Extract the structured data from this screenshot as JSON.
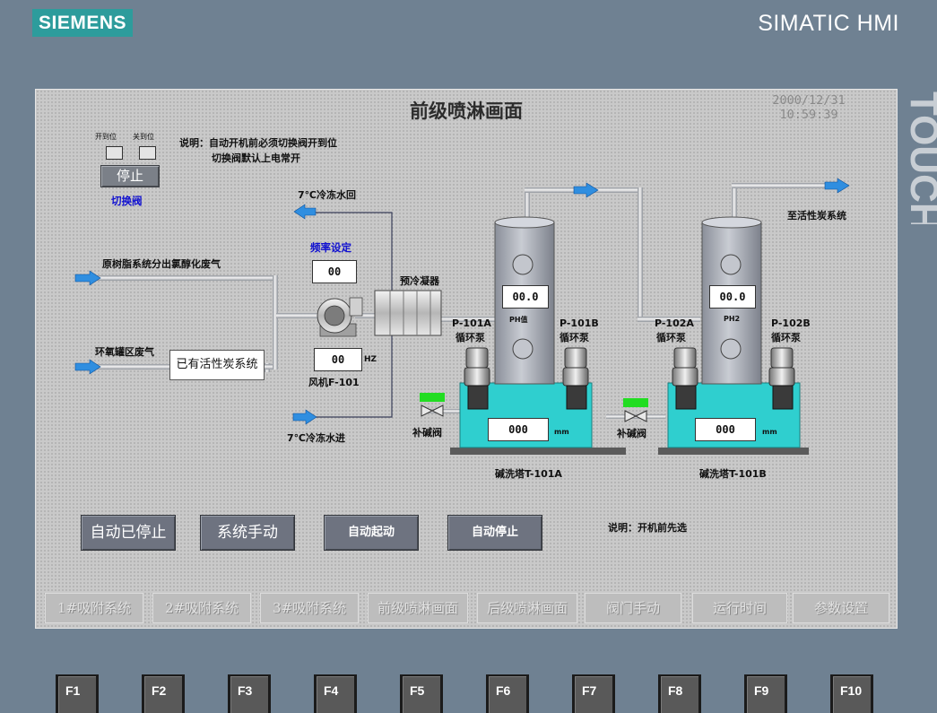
{
  "brand": "SIEMENS",
  "product": "SIMATIC HMI",
  "touch_label": "TOUCH",
  "screen": {
    "title": "前级喷淋画面",
    "date": "2000/12/31",
    "time": "10:59:39",
    "note_line1": "说明：自动开机前必须切换阀开到位",
    "note_line2": "切换阀默认上电常开",
    "note_bottom": "说明：开机前先选"
  },
  "switch_valve": {
    "open_label": "开到位",
    "close_label": "关到位",
    "button_label": "停止",
    "name": "切换阀"
  },
  "labels": {
    "cold_return": "7℃冷冻水回",
    "cold_in": "7℃冷冻水进",
    "freq_title": "频率设定",
    "source_gas": "原树脂系统分出氯醇化废气",
    "epoxy_gas": "环氧罐区废气",
    "carbon_system": "已有活性炭系统",
    "fan": "风机F-101",
    "precooler": "预冷凝器",
    "to_carbon": "至活性炭系统",
    "ph1": "PH值",
    "ph2": "PH2",
    "p101a": "P-101A",
    "p101b": "P-101B",
    "p102a": "P-102A",
    "p102b": "P-102B",
    "pump": "循环泵",
    "alkali_valve": "补碱阀",
    "tower_a": "碱洗塔T-101A",
    "tower_b": "碱洗塔T-101B",
    "hz": "HZ",
    "mm": "mm"
  },
  "values": {
    "freq_set": "00",
    "fan_freq": "00",
    "ph1": "00.0",
    "ph2": "00.0",
    "level_a": "000",
    "level_b": "000"
  },
  "control_buttons": {
    "auto_status": "自动已停止",
    "mode": "系统手动",
    "auto_start": "自动起动",
    "auto_stop": "自动停止"
  },
  "nav": [
    "1#吸附系统",
    "2#吸附系统",
    "3#吸附系统",
    "前级喷淋画面",
    "后级喷淋画面",
    "阀门手动",
    "运行时间",
    "参数设置"
  ],
  "fkeys": [
    "F1",
    "F2",
    "F3",
    "F4",
    "F5",
    "F6",
    "F7",
    "F8",
    "F9",
    "F10"
  ],
  "colors": {
    "bezel": "#6f8192",
    "brand": "#2d9c9c",
    "tank_base": "#2fcfcf",
    "valve_indicator": "#22dd22",
    "tower": "#a9aeb8"
  }
}
